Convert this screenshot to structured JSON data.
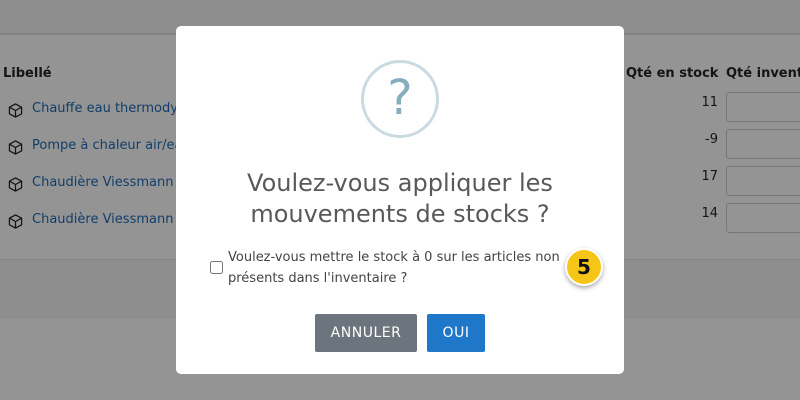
{
  "table": {
    "headers": {
      "libelle": "Libellé",
      "qte_stock": "Qté en stock",
      "qte_inventaire": "Qté inventa"
    },
    "rows": [
      {
        "label": "Chauffe eau thermodyn",
        "stock": "11",
        "inventory": "1"
      },
      {
        "label": "Pompe à chaleur air/eau",
        "stock": "-9",
        "inventory": ""
      },
      {
        "label": "Chaudière Viessmann g",
        "stock": "17",
        "inventory": "1"
      },
      {
        "label": "Chaudière Viessmann g",
        "stock": "14",
        "inventory": "1"
      }
    ]
  },
  "modal": {
    "icon": "question-icon",
    "icon_glyph": "?",
    "title": "Voulez-vous appliquer les mouvements de stocks ?",
    "checkbox_label": "Voulez-vous mettre le stock à 0 sur les articles non présents dans l'inventaire ?",
    "checkbox_checked": false,
    "cancel_label": "ANNULER",
    "confirm_label": "OUI"
  },
  "step_badge": {
    "number": "5"
  },
  "colors": {
    "link": "#1f6bb5",
    "cancel_button": "#6c757d",
    "confirm_button": "#1f77c9",
    "badge": "#f5c518"
  }
}
